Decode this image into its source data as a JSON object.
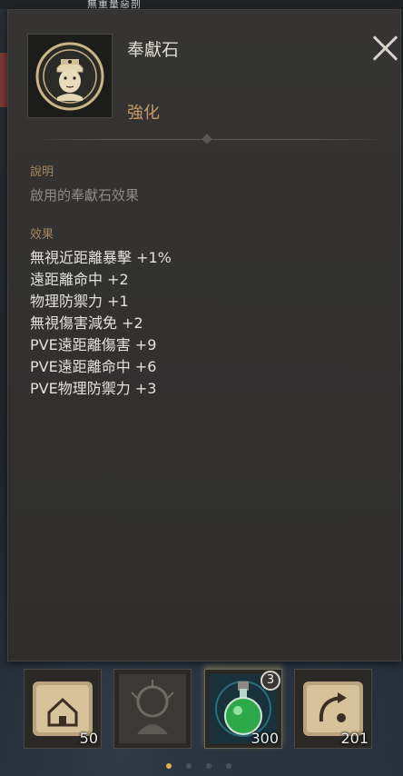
{
  "header": {
    "title": "無重量惡剖"
  },
  "tooltip": {
    "item_name": "奉獻石",
    "item_grade": "強化",
    "item_icon": "offering-stone-icon",
    "description_label": "說明",
    "description": "啟用的奉獻石效果",
    "effects_label": "效果",
    "effects": [
      "無視近距離暴擊 +1%",
      "遠距離命中 +2",
      "物理防禦力 +1",
      "無視傷害減免 +2",
      "PVE遠距離傷害 +9",
      "PVE遠距離命中 +6",
      "PVE物理防禦力 +3"
    ],
    "close_icon": "close-icon"
  },
  "quickbar": {
    "slots": [
      {
        "icon": "return-home-scroll-icon",
        "count": "50"
      },
      {
        "icon": "locked-skill-icon",
        "count": ""
      },
      {
        "icon": "green-potion-icon",
        "count": "300",
        "badge": "3"
      },
      {
        "icon": "teleport-scroll-icon",
        "count": "201"
      }
    ],
    "page_dots": 4,
    "active_page": 1
  },
  "colors": {
    "grade": "#c69a63",
    "section_label": "#a58660",
    "panel": "#333230",
    "active_dot": "#e0b44a"
  }
}
